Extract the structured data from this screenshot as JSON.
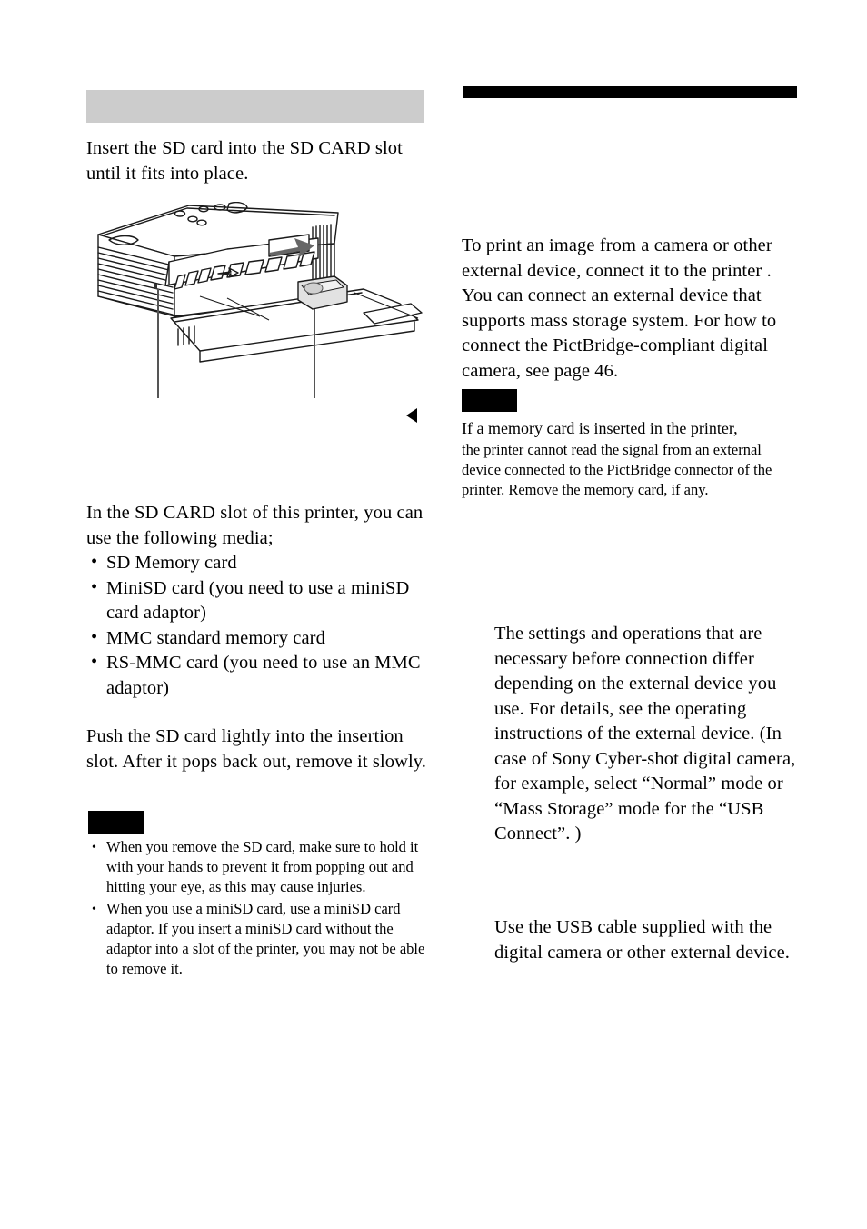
{
  "document": {
    "type": "printer-instruction-manual-page",
    "columns": 2
  },
  "colors": {
    "gray_heading_bar": "#cccccc",
    "black_rule": "#000000",
    "note_tag": "#000000",
    "text": "#000000",
    "page_background": "#ffffff"
  },
  "left_column": {
    "heading_bar": {
      "label": "",
      "redacted": true
    },
    "intro_paragraph": "Insert the SD card into the SD CARD slot until it fits into place.",
    "figure": {
      "name": "printer-sd-card-insertion-illustration",
      "caption": "",
      "callout_labels": [
        "",
        ""
      ],
      "pointer_marker": "◀"
    },
    "media_paragraph": "In the SD CARD slot of this printer, you can use the following media;",
    "media_list": [
      "SD Memory card",
      "MiniSD card (you need to use a miniSD card adaptor)",
      "MMC standard memory card",
      "RS-MMC card (you need to use an MMC adaptor)"
    ],
    "remove_paragraph": "Push the SD card lightly into the insertion slot.  After it pops back out,  remove it slowly.",
    "note_tag": {
      "label": "",
      "redacted": true
    },
    "notes": [
      "When you remove the SD card, make sure to hold it with your hands to prevent it from popping out and hitting your eye, as this may cause injuries.",
      "When you use a miniSD card, use a miniSD card adaptor.  If you insert a miniSD card without the adaptor into a slot of the printer, you may not be able to remove it."
    ]
  },
  "right_column": {
    "heading_rule": {
      "label": "",
      "redacted": true
    },
    "connect_paragraph": "To print an image from a camera or other external device, connect it to the printer . You can connect an external device that supports mass storage system. For how to connect the PictBridge-compliant digital camera, see page 46.",
    "note_tag": {
      "label": "",
      "redacted": true
    },
    "note_lead": "If a memory card is inserted in the printer,",
    "note_body": "the printer cannot read the signal from an external device connected to the PictBridge connector of the printer. Remove the memory card, if any.",
    "settings_paragraph": "The settings and operations that are necessary before connection differ depending on the external device you use. For details, see the operating instructions of the external device. (In case of Sony Cyber-shot digital camera, for example, select “Normal” mode or “Mass Storage” mode for the “USB Connect”. )",
    "usb_paragraph": "Use the USB cable supplied with the digital camera or other external device."
  }
}
